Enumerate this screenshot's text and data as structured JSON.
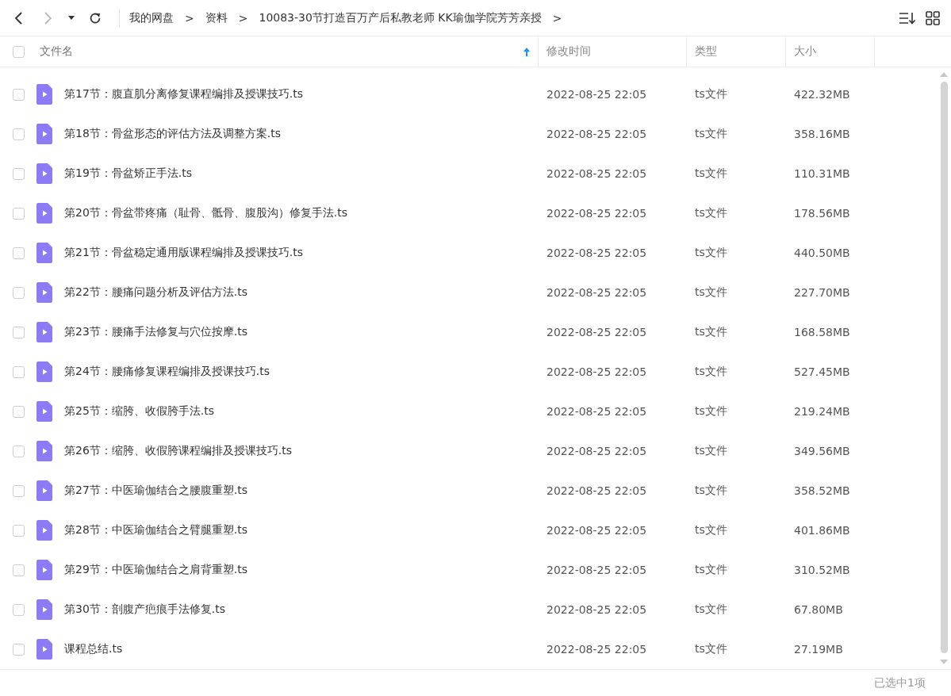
{
  "toolbar": {
    "breadcrumbs": [
      "我的网盘",
      "资料",
      "10083-30节打造百万产后私教老师 KK瑜伽学院芳芳亲授"
    ],
    "separator": ">"
  },
  "table": {
    "select_all": {
      "checked": false
    },
    "columns": [
      {
        "label": "文件名",
        "sorted": true
      },
      {
        "label": "修改时间",
        "sorted": false
      },
      {
        "label": "类型",
        "sorted": false
      },
      {
        "label": "大小",
        "sorted": false
      }
    ],
    "rows": [
      {
        "name": "第17节：腹直肌分离修复课程编排及授课技巧.ts",
        "modified": "2022-08-25 22:05",
        "type": "ts文件",
        "size": "422.32MB",
        "checked": false
      },
      {
        "name": "第18节：骨盆形态的评估方法及调整方案.ts",
        "modified": "2022-08-25 22:05",
        "type": "ts文件",
        "size": "358.16MB",
        "checked": false
      },
      {
        "name": "第19节：骨盆矫正手法.ts",
        "modified": "2022-08-25 22:05",
        "type": "ts文件",
        "size": "110.31MB",
        "checked": false
      },
      {
        "name": "第20节：骨盆带疼痛（耻骨、骶骨、腹股沟）修复手法.ts",
        "modified": "2022-08-25 22:05",
        "type": "ts文件",
        "size": "178.56MB",
        "checked": false
      },
      {
        "name": "第21节：骨盆稳定通用版课程编排及授课技巧.ts",
        "modified": "2022-08-25 22:05",
        "type": "ts文件",
        "size": "440.50MB",
        "checked": false
      },
      {
        "name": "第22节：腰痛问题分析及评估方法.ts",
        "modified": "2022-08-25 22:05",
        "type": "ts文件",
        "size": "227.70MB",
        "checked": false
      },
      {
        "name": "第23节：腰痛手法修复与穴位按摩.ts",
        "modified": "2022-08-25 22:05",
        "type": "ts文件",
        "size": "168.58MB",
        "checked": false
      },
      {
        "name": "第24节：腰痛修复课程编排及授课技巧.ts",
        "modified": "2022-08-25 22:05",
        "type": "ts文件",
        "size": "527.45MB",
        "checked": false
      },
      {
        "name": "第25节：缩胯、收假胯手法.ts",
        "modified": "2022-08-25 22:05",
        "type": "ts文件",
        "size": "219.24MB",
        "checked": false
      },
      {
        "name": "第26节：缩胯、收假胯课程编排及授课技巧.ts",
        "modified": "2022-08-25 22:05",
        "type": "ts文件",
        "size": "349.56MB",
        "checked": false
      },
      {
        "name": "第27节：中医瑜伽结合之腰腹重塑.ts",
        "modified": "2022-08-25 22:05",
        "type": "ts文件",
        "size": "358.52MB",
        "checked": false
      },
      {
        "name": "第28节：中医瑜伽结合之臂腿重塑.ts",
        "modified": "2022-08-25 22:05",
        "type": "ts文件",
        "size": "401.86MB",
        "checked": false
      },
      {
        "name": "第29节：中医瑜伽结合之肩背重塑.ts",
        "modified": "2022-08-25 22:05",
        "type": "ts文件",
        "size": "310.52MB",
        "checked": false
      },
      {
        "name": "第30节：剖腹产疤痕手法修复.ts",
        "modified": "2022-08-25 22:05",
        "type": "ts文件",
        "size": "67.80MB",
        "checked": false
      },
      {
        "name": "课程总结.ts",
        "modified": "2022-08-25 22:05",
        "type": "ts文件",
        "size": "27.19MB",
        "checked": false
      }
    ]
  },
  "status_bar": {
    "selection": "已选中1项"
  }
}
